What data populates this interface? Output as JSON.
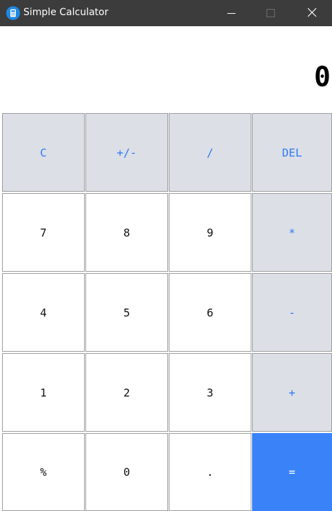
{
  "window": {
    "title": "Simple Calculator",
    "app_icon": "calculator-icon",
    "controls": {
      "minimize_icon": "minimize-icon",
      "maximize_icon": "maximize-icon",
      "close_icon": "close-icon"
    }
  },
  "display": {
    "value": "0"
  },
  "keys": {
    "clear": "C",
    "sign": "+/-",
    "divide": "/",
    "delete": "DEL",
    "seven": "7",
    "eight": "8",
    "nine": "9",
    "multiply": "*",
    "four": "4",
    "five": "5",
    "six": "6",
    "subtract": "-",
    "one": "1",
    "two": "2",
    "three": "3",
    "add": "+",
    "percent": "%",
    "zero": "0",
    "decimal": ".",
    "equals": "="
  },
  "colors": {
    "titlebar": "#3c3c3c",
    "operator_key_bg": "#dcdfe6",
    "operator_text": "#2f7bf5",
    "equals_bg": "#3a82f7",
    "number_key_bg": "#ffffff"
  }
}
